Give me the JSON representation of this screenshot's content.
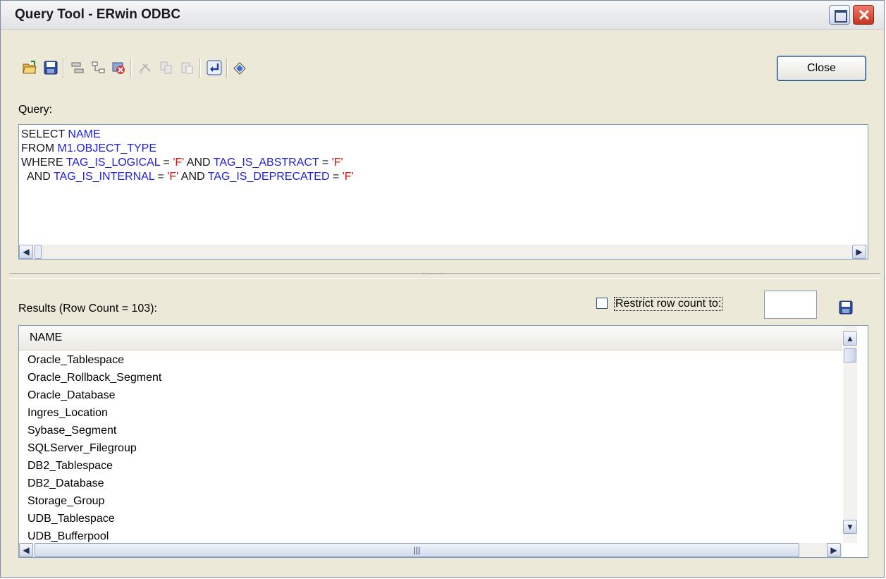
{
  "window": {
    "title": "Query Tool - ERwin ODBC"
  },
  "toolbar": {
    "close_label": "Close",
    "icons": [
      "open-icon",
      "save-icon",
      "connect-icon",
      "schema-icon",
      "disconnect-icon",
      "cut-icon",
      "copy-icon",
      "paste-icon",
      "execute-icon",
      "clear-icon"
    ]
  },
  "query": {
    "label": "Query:",
    "lines": [
      [
        {
          "t": "SELECT ",
          "c": "kw"
        },
        {
          "t": "NAME",
          "c": "id"
        }
      ],
      [
        {
          "t": "FROM ",
          "c": "kw"
        },
        {
          "t": "M1.OBJECT_TYPE",
          "c": "id"
        }
      ],
      [
        {
          "t": "WHERE ",
          "c": "kw"
        },
        {
          "t": "TAG_IS_LOGICAL",
          "c": "id"
        },
        {
          "t": " = ",
          "c": "kw"
        },
        {
          "t": "'F'",
          "c": "str"
        },
        {
          "t": " AND ",
          "c": "kw"
        },
        {
          "t": "TAG_IS_ABSTRACT",
          "c": "id"
        },
        {
          "t": " = ",
          "c": "kw"
        },
        {
          "t": "'F'",
          "c": "str"
        }
      ],
      [
        {
          "t": "  AND ",
          "c": "kw"
        },
        {
          "t": "TAG_IS_INTERNAL",
          "c": "id"
        },
        {
          "t": " = ",
          "c": "kw"
        },
        {
          "t": "'F'",
          "c": "str"
        },
        {
          "t": " AND ",
          "c": "kw"
        },
        {
          "t": "TAG_IS_DEPRECATED",
          "c": "id"
        },
        {
          "t": " = ",
          "c": "kw"
        },
        {
          "t": "'F'",
          "c": "str"
        }
      ]
    ]
  },
  "results": {
    "label": "Results (Row Count = 103):",
    "restrict_label": "Restrict row count to:",
    "restrict_checked": false,
    "restrict_value": "",
    "column": "NAME",
    "rows": [
      "Oracle_Tablespace",
      "Oracle_Rollback_Segment",
      "Oracle_Database",
      "Ingres_Location",
      "Sybase_Segment",
      "SQLServer_Filegroup",
      "DB2_Tablespace",
      "DB2_Database",
      "Storage_Group",
      "UDB_Tablespace",
      "UDB_Bufferpool"
    ]
  },
  "colors": {
    "keyword": "#1a1a1a",
    "identifier": "#2020e0",
    "string": "#e01010"
  }
}
